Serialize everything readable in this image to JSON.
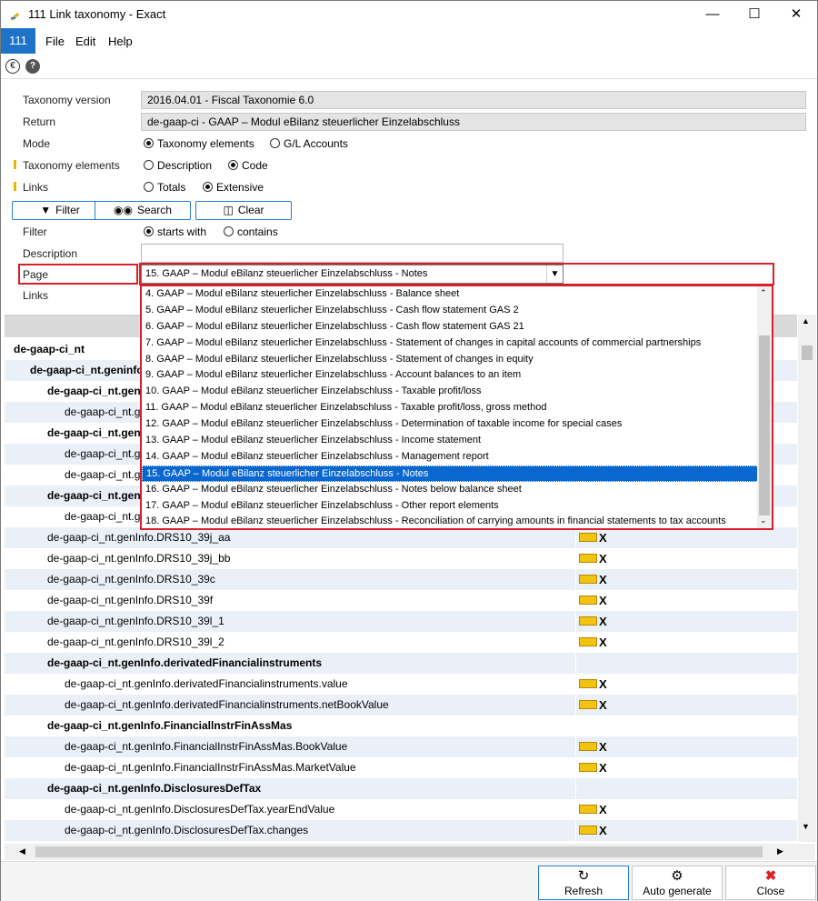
{
  "window": {
    "title": "111 Link taxonomy - Exact"
  },
  "menu": {
    "app": "111",
    "file": "File",
    "edit": "Edit",
    "help": "Help"
  },
  "form": {
    "taxonomy_version_label": "Taxonomy version",
    "taxonomy_version_value": "2016.04.01 - Fiscal Taxonomie 6.0",
    "return_label": "Return",
    "return_value": "de-gaap-ci - GAAP – Modul eBilanz steuerlicher Einzelabschluss",
    "mode_label": "Mode",
    "mode_opt1": "Taxonomy elements",
    "mode_opt2": "G/L Accounts",
    "taxonomy_elements_label": "Taxonomy elements",
    "te_opt1": "Description",
    "te_opt2": "Code",
    "links_label": "Links",
    "links_opt1": "Totals",
    "links_opt2": "Extensive",
    "filter_btn": "Filter",
    "search_btn": "Search",
    "clear_btn": "Clear",
    "filter_label": "Filter",
    "filter_opt1": "starts with",
    "filter_opt2": "contains",
    "description_label": "Description",
    "page_label": "Page",
    "page_value": "15.  GAAP – Modul eBilanz steuerlicher Einzelabschluss - Notes",
    "links2_label": "Links"
  },
  "dropdown": [
    "4.  GAAP – Modul eBilanz steuerlicher Einzelabschluss - Balance sheet",
    "5.  GAAP – Modul eBilanz steuerlicher Einzelabschluss - Cash flow statement GAS 2",
    "6.  GAAP – Modul eBilanz steuerlicher Einzelabschluss - Cash flow statement GAS 21",
    "7.  GAAP – Modul eBilanz steuerlicher Einzelabschluss - Statement of changes in capital accounts of commercial partnerships",
    "8.  GAAP – Modul eBilanz steuerlicher Einzelabschluss - Statement of changes in equity",
    "9.  GAAP – Modul eBilanz steuerlicher Einzelabschluss - Account balances to an item",
    "10.  GAAP – Modul eBilanz steuerlicher Einzelabschluss - Taxable profit/loss",
    "11.  GAAP – Modul eBilanz steuerlicher Einzelabschluss - Taxable profit/loss, gross method",
    "12.  GAAP – Modul eBilanz steuerlicher Einzelabschluss - Determination of taxable income for special cases",
    "13.  GAAP – Modul eBilanz steuerlicher Einzelabschluss - Income statement",
    "14.  GAAP – Modul eBilanz steuerlicher Einzelabschluss - Management report",
    "15.  GAAP – Modul eBilanz steuerlicher Einzelabschluss - Notes",
    "16.  GAAP – Modul eBilanz steuerlicher Einzelabschluss - Notes below balance sheet",
    "17.  GAAP – Modul eBilanz steuerlicher Einzelabschluss - Other report elements",
    "18.  GAAP – Modul eBilanz steuerlicher Einzelabschluss - Reconciliation of carrying amounts in financial statements to tax accounts"
  ],
  "grid_rows": [
    {
      "text": "de-gaap-ci_nt",
      "bold": true,
      "indent": 0,
      "link": false
    },
    {
      "text": "de-gaap-ci_nt.geninfo",
      "bold": true,
      "indent": 1,
      "link": false
    },
    {
      "text": "de-gaap-ci_nt.gen",
      "bold": true,
      "indent": 2,
      "link": false
    },
    {
      "text": "de-gaap-ci_nt.g",
      "bold": false,
      "indent": 3,
      "link": false
    },
    {
      "text": "de-gaap-ci_nt.gen",
      "bold": true,
      "indent": 2,
      "link": false
    },
    {
      "text": "de-gaap-ci_nt.g",
      "bold": false,
      "indent": 3,
      "link": false
    },
    {
      "text": "de-gaap-ci_nt.g",
      "bold": false,
      "indent": 3,
      "link": false
    },
    {
      "text": "de-gaap-ci_nt.gen",
      "bold": true,
      "indent": 2,
      "link": false
    },
    {
      "text": "de-gaap-ci_nt.g",
      "bold": false,
      "indent": 3,
      "link": false
    },
    {
      "text": "de-gaap-ci_nt.genInfo.DRS10_39j_aa",
      "bold": false,
      "indent": 2,
      "link": true
    },
    {
      "text": "de-gaap-ci_nt.genInfo.DRS10_39j_bb",
      "bold": false,
      "indent": 2,
      "link": true
    },
    {
      "text": "de-gaap-ci_nt.genInfo.DRS10_39c",
      "bold": false,
      "indent": 2,
      "link": true
    },
    {
      "text": "de-gaap-ci_nt.genInfo.DRS10_39f",
      "bold": false,
      "indent": 2,
      "link": true
    },
    {
      "text": "de-gaap-ci_nt.genInfo.DRS10_39l_1",
      "bold": false,
      "indent": 2,
      "link": true
    },
    {
      "text": "de-gaap-ci_nt.genInfo.DRS10_39l_2",
      "bold": false,
      "indent": 2,
      "link": true
    },
    {
      "text": "de-gaap-ci_nt.genInfo.derivatedFinancialinstruments",
      "bold": true,
      "indent": 2,
      "link": false
    },
    {
      "text": "de-gaap-ci_nt.genInfo.derivatedFinancialinstruments.value",
      "bold": false,
      "indent": 3,
      "link": true
    },
    {
      "text": "de-gaap-ci_nt.genInfo.derivatedFinancialinstruments.netBookValue",
      "bold": false,
      "indent": 3,
      "link": true
    },
    {
      "text": "de-gaap-ci_nt.genInfo.FinanciallnstrFinAssMas",
      "bold": true,
      "indent": 2,
      "link": false
    },
    {
      "text": "de-gaap-ci_nt.genInfo.FinancialInstrFinAssMas.BookValue",
      "bold": false,
      "indent": 3,
      "link": true
    },
    {
      "text": "de-gaap-ci_nt.genInfo.FinancialInstrFinAssMas.MarketValue",
      "bold": false,
      "indent": 3,
      "link": true
    },
    {
      "text": "de-gaap-ci_nt.genInfo.DisclosuresDefTax",
      "bold": true,
      "indent": 2,
      "link": false
    },
    {
      "text": "de-gaap-ci_nt.genInfo.DisclosuresDefTax.yearEndValue",
      "bold": false,
      "indent": 3,
      "link": true
    },
    {
      "text": "de-gaap-ci_nt.genInfo.DisclosuresDefTax.changes",
      "bold": false,
      "indent": 3,
      "link": true
    }
  ],
  "link_mark": "X",
  "footer": {
    "refresh": "Refresh",
    "auto_generate": "Auto generate",
    "close": "Close"
  }
}
